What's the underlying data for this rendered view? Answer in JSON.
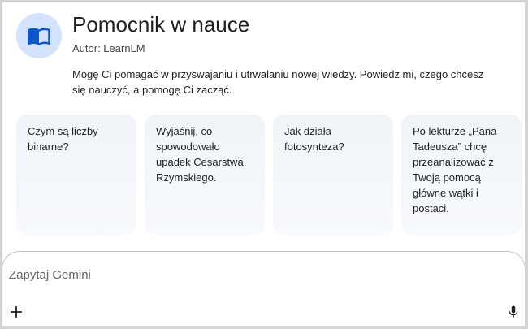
{
  "gem": {
    "title": "Pomocnik w nauce",
    "author": "Autor: LearnLM",
    "description": "Mogę Ci pomagać w przyswajaniu i utrwalaniu nowej wiedzy. Powiedz mi, czego chcesz się nauczyć, a pomogę Ci zacząć.",
    "icon": "open-book-icon",
    "accent_color": "#0b57d0",
    "avatar_bg": "#d3e3fd"
  },
  "suggestions": [
    {
      "text": "Czym są liczby binarne?"
    },
    {
      "text": "Wyjaśnij, co spowodowało upadek Cesarstwa Rzymskiego."
    },
    {
      "text": "Jak działa fotosynteza?"
    },
    {
      "text": "Po lekturze „Pana Tadeusza” chcę przeanalizować z Twoją pomocą główne wątki i postaci."
    }
  ],
  "prompt": {
    "placeholder": "Zapytaj Gemini",
    "value": "",
    "add_icon": "plus-icon",
    "mic_icon": "microphone-icon"
  }
}
